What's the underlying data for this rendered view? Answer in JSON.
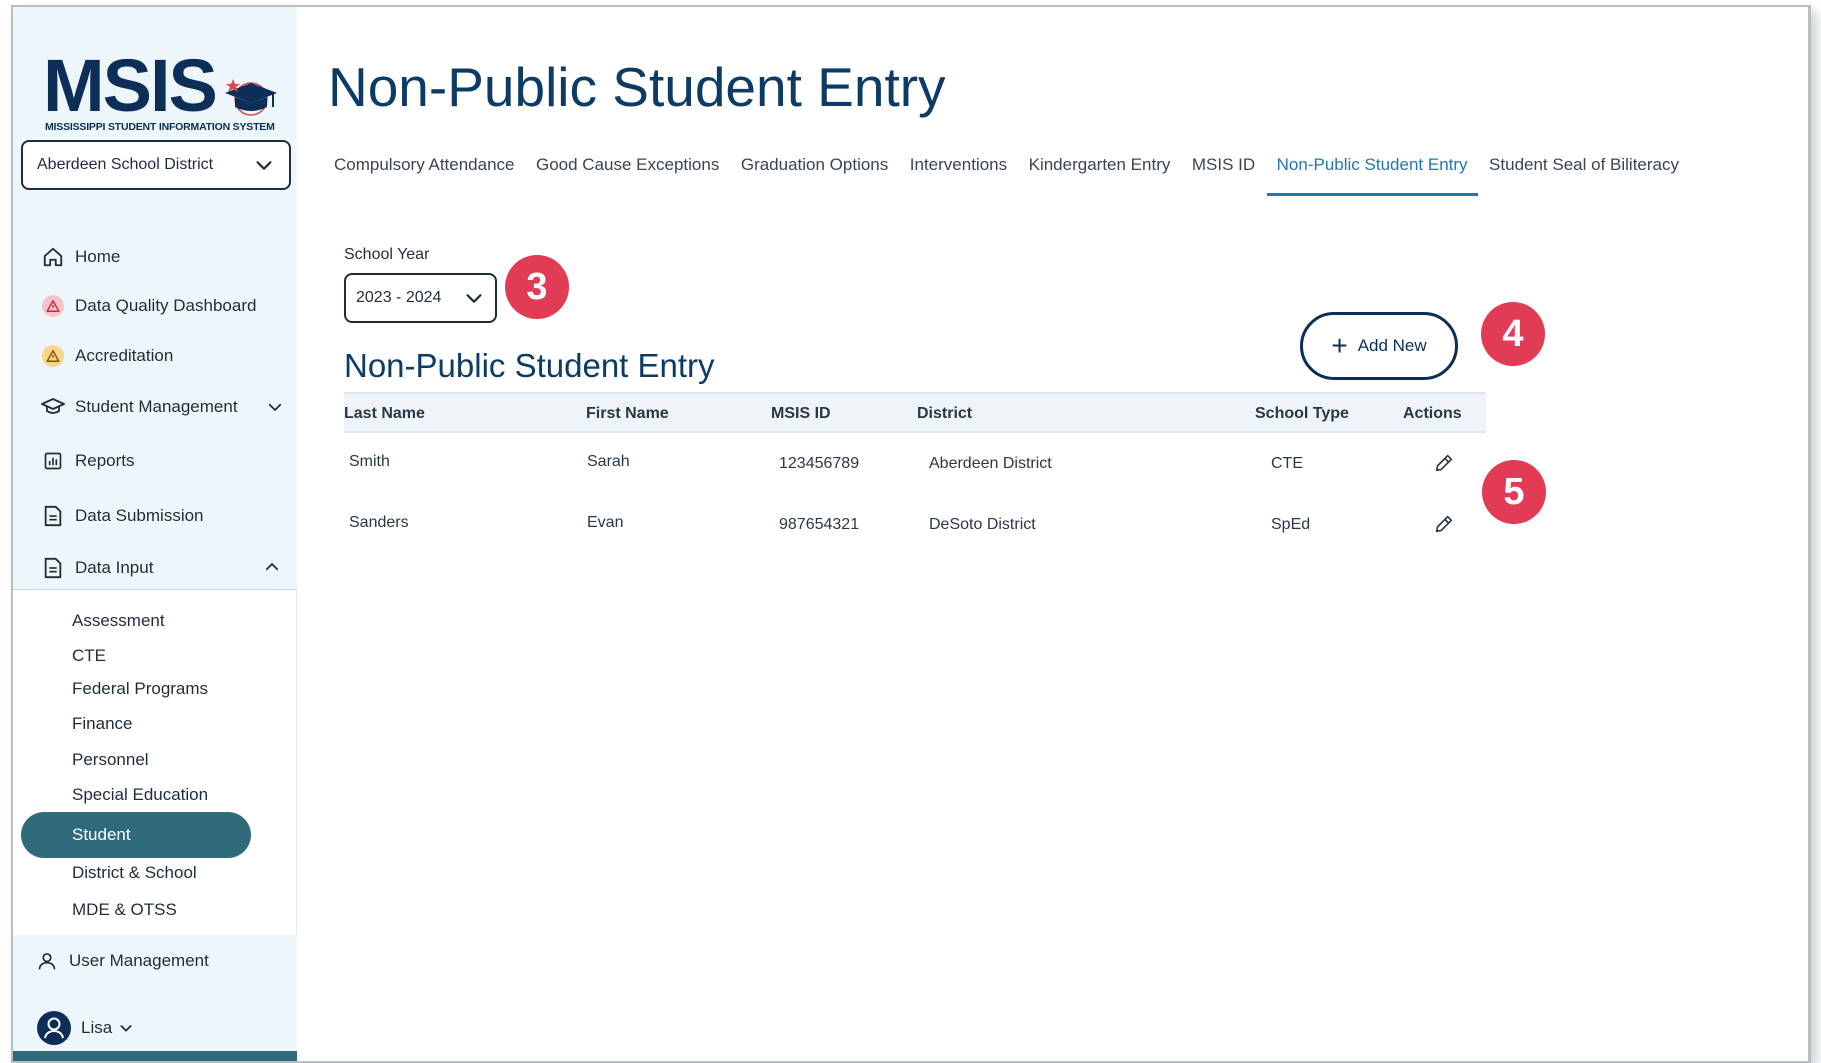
{
  "app": {
    "logo_text": "MSIS",
    "logo_subtitle": "MISSISSIPPI STUDENT INFORMATION SYSTEM",
    "district": "Aberdeen School District"
  },
  "sidebar": {
    "items": [
      {
        "label": "Home",
        "icon": "home-icon"
      },
      {
        "label": "Data Quality Dashboard",
        "icon": "alert-triangle-icon"
      },
      {
        "label": "Accreditation",
        "icon": "warning-icon"
      },
      {
        "label": "Student Management",
        "icon": "graduation-cap-icon"
      },
      {
        "label": "Reports",
        "icon": "bar-chart-icon"
      },
      {
        "label": "Data Submission",
        "icon": "document-icon"
      },
      {
        "label": "Data Input",
        "icon": "document-icon"
      }
    ],
    "data_input_children": [
      "Assessment",
      "CTE",
      "Federal Programs",
      "Finance",
      "Personnel",
      "Special Education",
      "Student",
      "District & School",
      "MDE & OTSS"
    ],
    "active_child": "Student",
    "user_management": "User Management",
    "user_name": "Lisa"
  },
  "page": {
    "title": "Non-Public Student Entry",
    "tabs": [
      "Compulsory Attendance",
      "Good Cause Exceptions",
      "Graduation Options",
      "Interventions",
      "Kindergarten Entry",
      "MSIS ID",
      "Non-Public Student Entry",
      "Student Seal of Biliteracy"
    ],
    "active_tab": "Non-Public Student Entry",
    "school_year_label": "School Year",
    "school_year_value": "2023 - 2024",
    "section_title": "Non-Public Student Entry",
    "add_new_label": "Add New"
  },
  "table": {
    "headers": [
      "Last Name",
      "First Name",
      "MSIS ID",
      "District",
      "School Type",
      "Actions"
    ],
    "rows": [
      [
        "Smith",
        "Sarah",
        "123456789",
        "Aberdeen District",
        "CTE"
      ],
      [
        "Sanders",
        "Evan",
        "987654321",
        "DeSoto District",
        "SpEd"
      ]
    ]
  },
  "annotations": {
    "badge_3": "3",
    "badge_4": "4",
    "badge_5": "5"
  },
  "colors": {
    "navy": "#0c2e57",
    "teal_active": "#2e6a7a",
    "tab_active": "#2577a8",
    "badge_red": "#e23b55",
    "sidebar_bg": "#edf6fa"
  }
}
